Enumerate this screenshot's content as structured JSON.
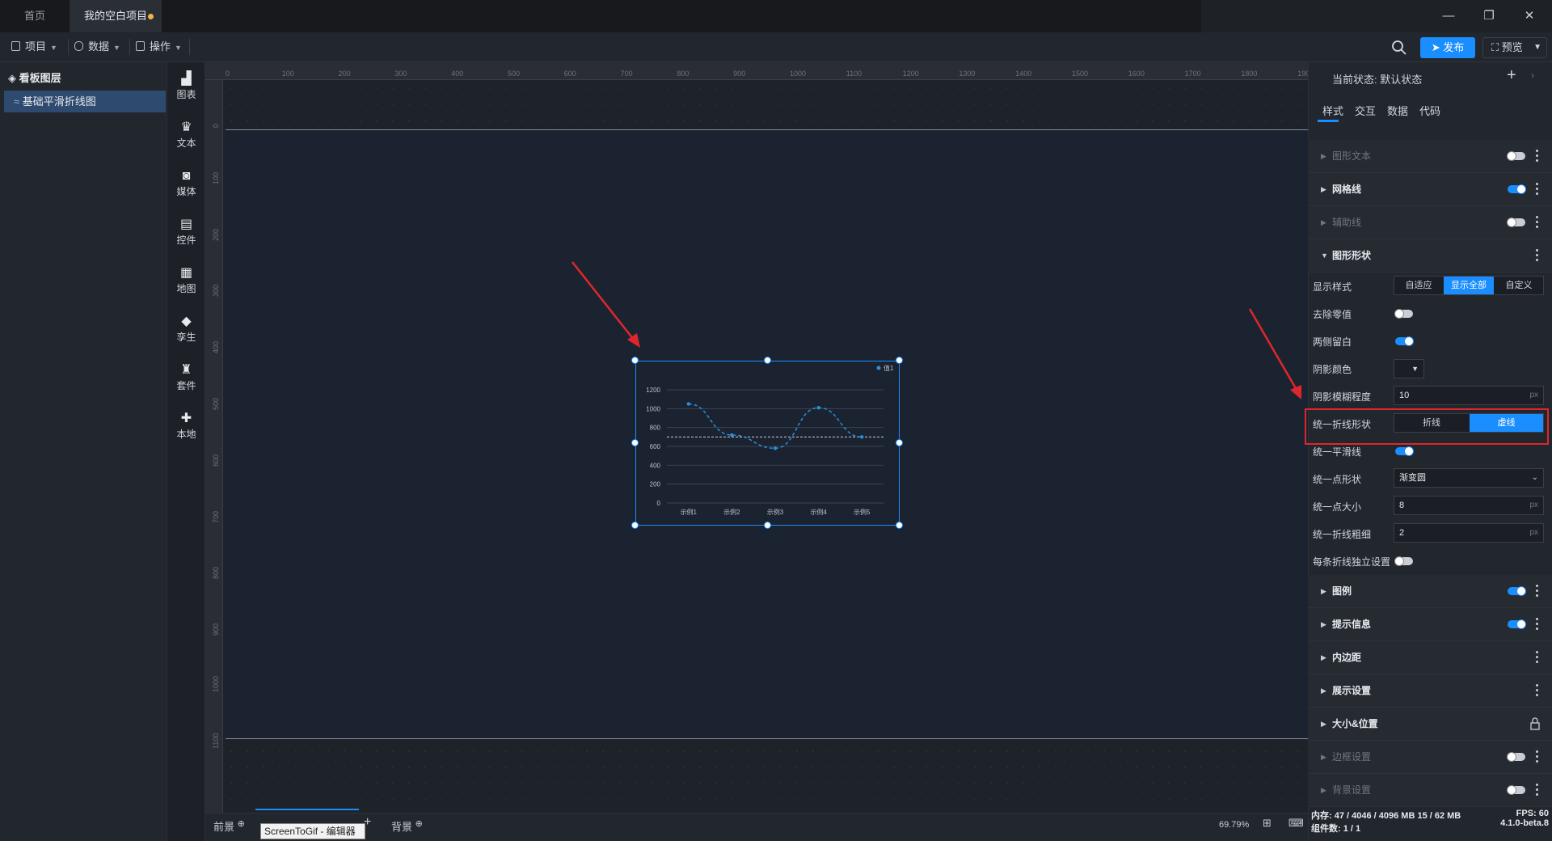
{
  "titlebar": {
    "tabs": [
      {
        "label": "首页"
      },
      {
        "label": "我的空白项目"
      }
    ],
    "modified_color": "#f3b541"
  },
  "menubar": {
    "items": [
      {
        "label": "项目",
        "icon": "file-icon"
      },
      {
        "label": "数据",
        "icon": "database-icon"
      },
      {
        "label": "操作",
        "icon": "grid-icon"
      }
    ],
    "publish_label": "发布",
    "preview_label": "预览",
    "accent": "#1a8dff"
  },
  "layers": {
    "title": "看板图层",
    "items": [
      {
        "label": "基础平滑折线图"
      }
    ]
  },
  "components": [
    {
      "label": "图表",
      "icon": "bar-chart-icon"
    },
    {
      "label": "文本",
      "icon": "text-icon"
    },
    {
      "label": "媒体",
      "icon": "media-icon"
    },
    {
      "label": "控件",
      "icon": "control-icon"
    },
    {
      "label": "地图",
      "icon": "map-icon"
    },
    {
      "label": "孪生",
      "icon": "cube-icon"
    },
    {
      "label": "套件",
      "icon": "shirt-icon"
    },
    {
      "label": "本地",
      "icon": "puzzle-icon"
    }
  ],
  "ruler": {
    "top_ticks": [
      "0",
      "100",
      "200",
      "300",
      "400",
      "500",
      "600",
      "700",
      "800",
      "900",
      "1000",
      "1100",
      "1200",
      "1300",
      "1400",
      "1500",
      "1600",
      "1700",
      "1800",
      "1900"
    ],
    "left_ticks": [
      "0",
      "100",
      "200",
      "300",
      "400",
      "500",
      "600",
      "700",
      "800",
      "900",
      "1000",
      "1100"
    ]
  },
  "chart_data": {
    "type": "line",
    "categories": [
      "示例1",
      "示例2",
      "示例3",
      "示例4",
      "示例5"
    ],
    "series": [
      {
        "name": "值1",
        "values": [
          1050,
          720,
          580,
          1010,
          700
        ]
      }
    ],
    "yticks": [
      "1200",
      "1000",
      "800",
      "600",
      "400",
      "200",
      "0"
    ],
    "ylim": [
      0,
      1200
    ],
    "smooth": true,
    "line_style": "dashed",
    "reference_line": 700,
    "color": "#2d8ed8",
    "legend": "top-right"
  },
  "bottombar": {
    "foreground_label": "前景",
    "background_label": "背景",
    "zoom": "69.79%",
    "gif_label": "ScreenToGif - 编辑器"
  },
  "rpanel": {
    "state_label": "当前状态:  默认状态",
    "tabs": [
      {
        "label": "样式"
      },
      {
        "label": "交互"
      },
      {
        "label": "数据"
      },
      {
        "label": "代码"
      }
    ],
    "sections_top": [
      {
        "label": "图形文本",
        "toggle": "off",
        "dim": true
      },
      {
        "label": "网格线",
        "toggle": "on",
        "dim": false
      },
      {
        "label": "辅助线",
        "toggle": "off",
        "dim": true
      },
      {
        "label": "图形形状",
        "toggle": "",
        "dim": false
      }
    ],
    "fields": {
      "display_style_label": "显示样式",
      "display_style_options": [
        "自适应",
        "显示全部",
        "自定义"
      ],
      "remove_zero_label": "去除零值",
      "both_sides_label": "两侧留白",
      "shadow_color_label": "阴影颜色",
      "shadow_blur_label": "阴影模糊程度",
      "shadow_blur_value": "10",
      "line_shape_label": "统一折线形状",
      "line_shape_options": [
        "折线",
        "虚线"
      ],
      "smooth_label": "统一平滑线",
      "point_shape_label": "统一点形状",
      "point_shape_value": "渐变圆",
      "point_size_label": "统一点大小",
      "point_size_value": "8",
      "line_width_label": "统一折线粗细",
      "line_width_value": "2",
      "independent_label": "每条折线独立设置",
      "unit": "px"
    },
    "sections_bottom": [
      {
        "label": "图例",
        "toggle": "on",
        "dim": false
      },
      {
        "label": "提示信息",
        "toggle": "on",
        "dim": false
      },
      {
        "label": "内边距",
        "toggle": "",
        "dim": false
      },
      {
        "label": "展示设置",
        "toggle": "",
        "dim": false
      },
      {
        "label": "大小&位置",
        "toggle": "lock",
        "dim": false
      },
      {
        "label": "边框设置",
        "toggle": "off",
        "dim": true
      },
      {
        "label": "背景设置",
        "toggle": "off",
        "dim": true
      }
    ],
    "status_left": [
      "内存: 47 / 4046 / 4096 MB  15 / 62 MB",
      "组件数: 1 / 1"
    ],
    "status_right": [
      "FPS: 60",
      "4.1.0-beta.8"
    ]
  }
}
